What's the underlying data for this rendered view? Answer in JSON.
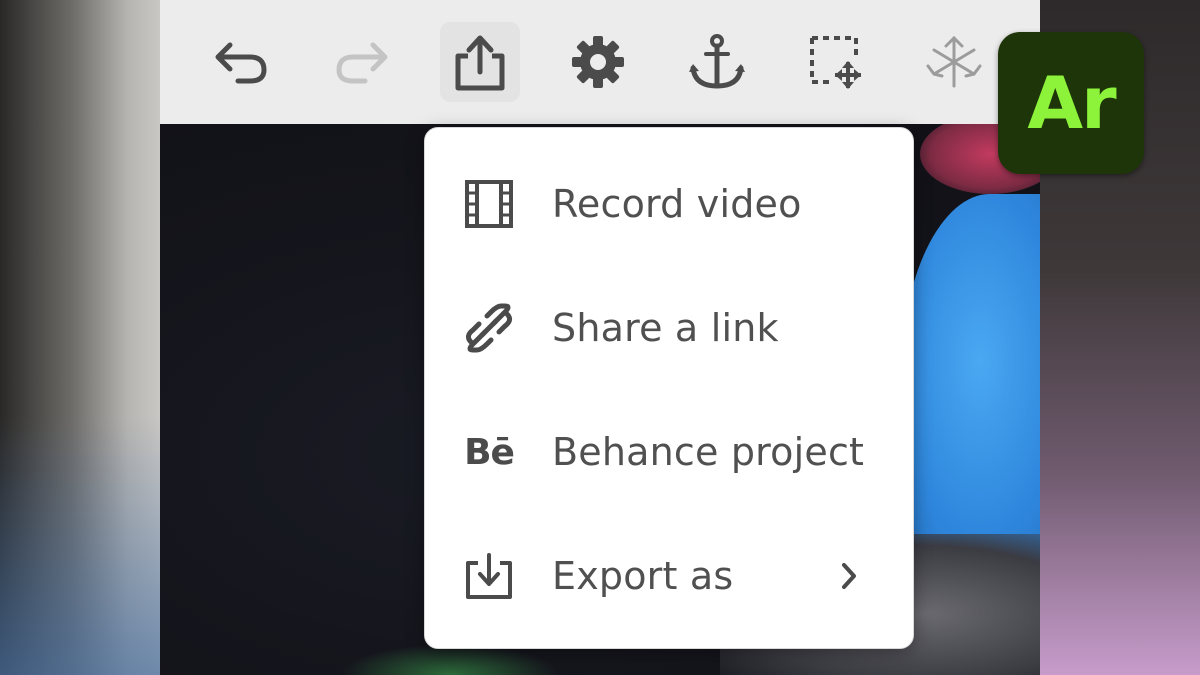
{
  "toolbar": {
    "tools": [
      {
        "id": "undo",
        "icon": "undo-icon",
        "enabled": true
      },
      {
        "id": "redo",
        "icon": "redo-icon",
        "enabled": false
      },
      {
        "id": "share",
        "icon": "share-icon",
        "enabled": true,
        "active": true
      },
      {
        "id": "settings",
        "icon": "gear-icon",
        "enabled": true
      },
      {
        "id": "anchor",
        "icon": "anchor-icon",
        "enabled": true
      },
      {
        "id": "select-move",
        "icon": "marquee-move-icon",
        "enabled": true
      },
      {
        "id": "transform",
        "icon": "transform-arrows-icon",
        "enabled": false
      }
    ]
  },
  "share_menu": {
    "items": [
      {
        "label": "Record video",
        "icon": "film-icon"
      },
      {
        "label": "Share a link",
        "icon": "link-icon"
      },
      {
        "label": "Behance project",
        "icon": "behance-icon",
        "glyph": "Bē"
      },
      {
        "label": "Export as",
        "icon": "export-icon",
        "has_submenu": true
      }
    ]
  },
  "app_badge": {
    "text": "Ar",
    "bg_color": "#1d3508",
    "text_color": "#8cf23a"
  },
  "colors": {
    "toolbar_bg": "#ececec",
    "icon_color": "#4b4b4b",
    "icon_disabled": "#c4c4c4",
    "menu_text": "#505050"
  }
}
